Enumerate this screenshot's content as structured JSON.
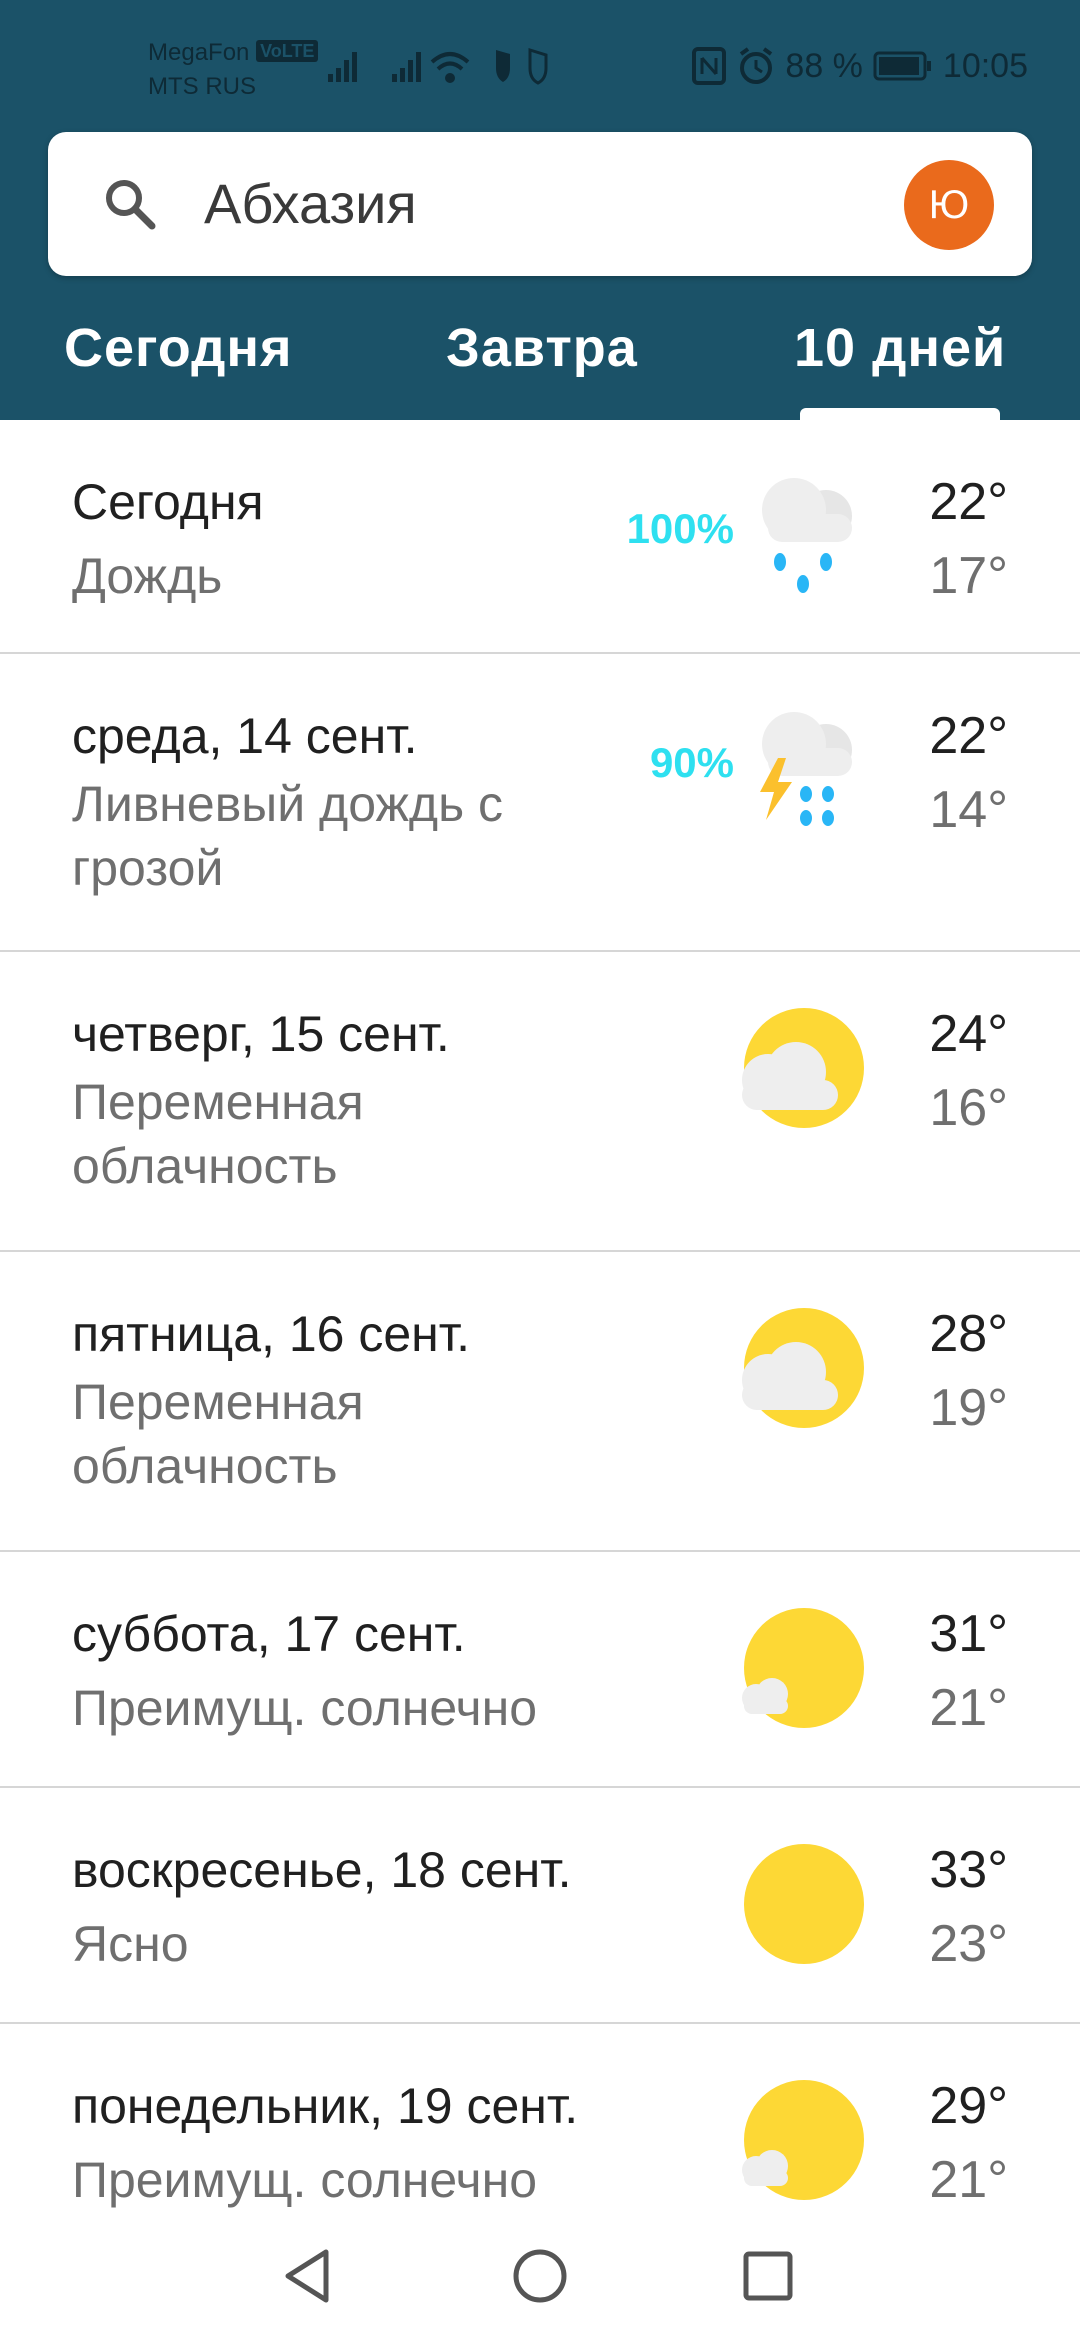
{
  "status_bar": {
    "carrier_1": "MegaFon",
    "volte": "VoLTE",
    "carrier_2": "MTS RUS",
    "battery": "88 %",
    "time": "10:05"
  },
  "search": {
    "location": "Абхазия",
    "avatar_letter": "Ю"
  },
  "tabs": [
    {
      "label": "Сегодня"
    },
    {
      "label": "Завтра"
    },
    {
      "label": "10 дней"
    }
  ],
  "forecast": [
    {
      "day": "Сегодня",
      "condition": "Дождь",
      "precip": "100%",
      "high": "22°",
      "low": "17°",
      "icon": "rain-cloud-icon"
    },
    {
      "day": "среда, 14 сент.",
      "condition": "Ливневый дождь с грозой",
      "precip": "90%",
      "high": "22°",
      "low": "14°",
      "icon": "thunderstorm-icon"
    },
    {
      "day": "четверг, 15 сент.",
      "condition": "Переменная облачность",
      "high": "24°",
      "low": "16°",
      "icon": "partly-cloudy-icon"
    },
    {
      "day": "пятница, 16 сент.",
      "condition": "Переменная облачность",
      "high": "28°",
      "low": "19°",
      "icon": "partly-cloudy-icon"
    },
    {
      "day": "суббота, 17 сент.",
      "condition": "Преимущ. солнечно",
      "high": "31°",
      "low": "21°",
      "icon": "mostly-sunny-icon"
    },
    {
      "day": "воскресенье, 18 сент.",
      "condition": "Ясно",
      "high": "33°",
      "low": "23°",
      "icon": "sunny-icon"
    },
    {
      "day": "понедельник, 19 сент.",
      "condition": "Преимущ. солнечно",
      "high": "29°",
      "low": "21°",
      "icon": "mostly-sunny-icon"
    }
  ],
  "colors": {
    "header_bg": "#1b5268",
    "precip_text": "#2ee0f0",
    "avatar_bg": "#ea6a1c",
    "sun": "#fdd835"
  }
}
